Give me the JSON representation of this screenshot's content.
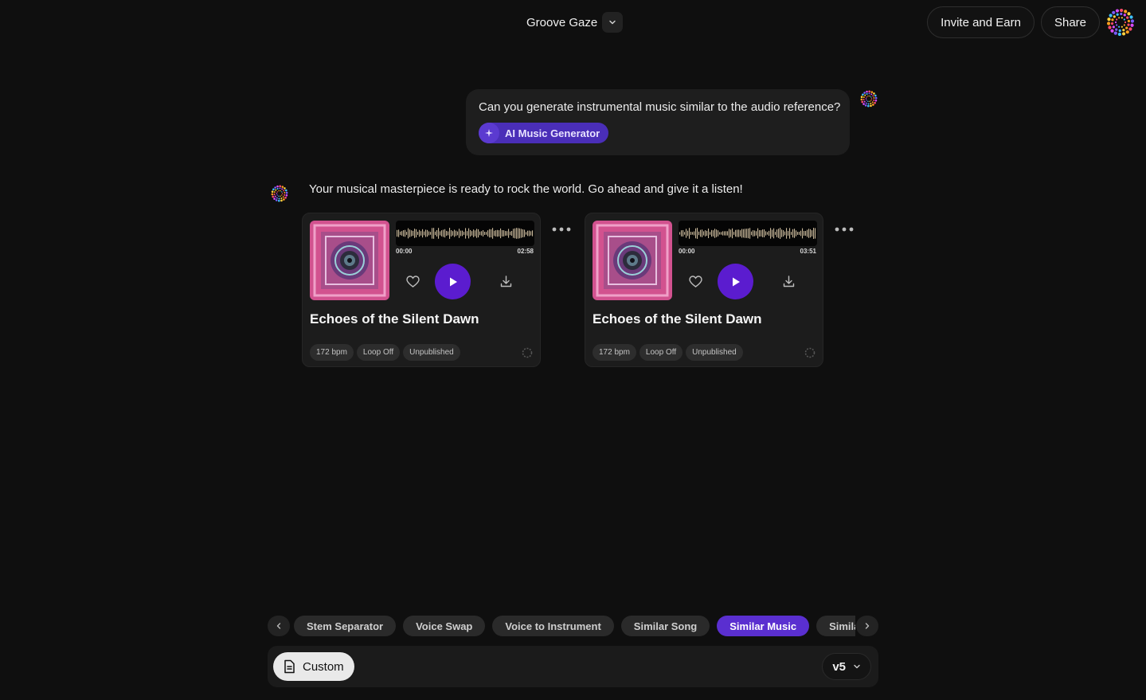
{
  "header": {
    "project_title": "Groove Gaze",
    "title_menu_icon": "chevron-down-icon",
    "invite_label": "Invite and Earn",
    "share_label": "Share",
    "profile_icon": "dotted-sunburst-avatar"
  },
  "conversation": {
    "user_message": {
      "text": "Can you generate instrumental music similar to the audio reference?",
      "tool_label": "AI Music Generator",
      "tool_icon": "sparkle-icon"
    },
    "assistant_message": {
      "text": "Your musical masterpiece is ready to rock the world. Go ahead and give it a listen!",
      "tracks": [
        {
          "title": "Echoes of the Silent Dawn",
          "time_start": "00:00",
          "time_end": "02:58",
          "tags": [
            "172 bpm",
            "Loop Off",
            "Unpublished"
          ]
        },
        {
          "title": "Echoes of the Silent Dawn",
          "time_start": "00:00",
          "time_end": "03:51",
          "tags": [
            "172 bpm",
            "Loop Off",
            "Unpublished"
          ]
        }
      ]
    }
  },
  "tools_bar": {
    "chips": [
      "Stem Separator",
      "Voice Swap",
      "Voice to Instrument",
      "Similar Song",
      "Similar Music",
      "Similar Singer"
    ],
    "active_chip": "Similar Music"
  },
  "composer": {
    "mode_label": "Custom",
    "model_label": "v5"
  },
  "colors": {
    "background": "#0f0f0f",
    "accent": "#5b1ccf",
    "active_chip": "#5a2fd0",
    "card": "#1c1c1c"
  }
}
